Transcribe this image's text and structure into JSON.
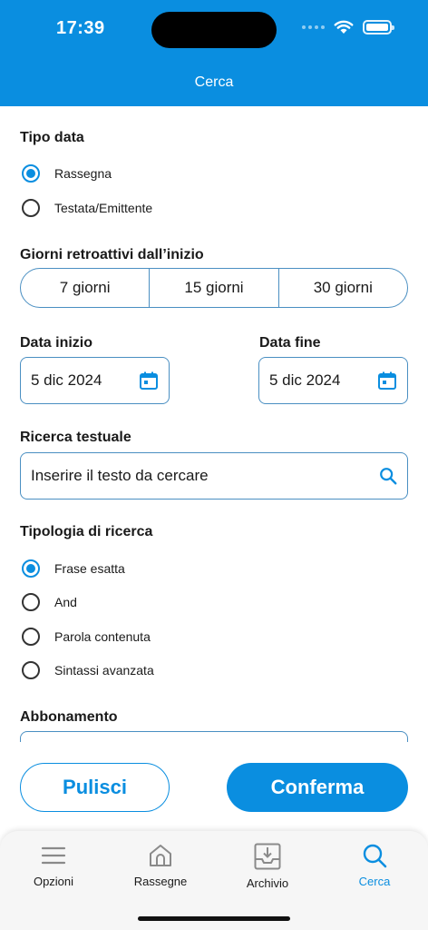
{
  "status_bar": {
    "time": "17:39"
  },
  "header": {
    "title": "Cerca"
  },
  "tipo_data": {
    "label": "Tipo data",
    "options": [
      {
        "label": "Rassegna",
        "checked": true
      },
      {
        "label": "Testata/Emittente",
        "checked": false
      }
    ]
  },
  "giorni": {
    "label": "Giorni retroattivi dall’inizio",
    "options": [
      "7 giorni",
      "15 giorni",
      "30 giorni"
    ]
  },
  "data_inizio": {
    "label": "Data inizio",
    "value": "5 dic 2024"
  },
  "data_fine": {
    "label": "Data fine",
    "value": "5 dic 2024"
  },
  "ricerca": {
    "label": "Ricerca testuale",
    "placeholder": "Inserire il testo da cercare"
  },
  "tipologia": {
    "label": "Tipologia di ricerca",
    "options": [
      {
        "label": "Frase esatta",
        "checked": true
      },
      {
        "label": "And",
        "checked": false
      },
      {
        "label": "Parola contenuta",
        "checked": false
      },
      {
        "label": "Sintassi avanzata",
        "checked": false
      }
    ]
  },
  "abbonamento": {
    "label": "Abbonamento"
  },
  "actions": {
    "clear": "Pulisci",
    "confirm": "Conferma"
  },
  "tabbar": {
    "items": [
      {
        "label": "Opzioni",
        "icon": "menu-icon"
      },
      {
        "label": "Rassegne",
        "icon": "home-icon"
      },
      {
        "label": "Archivio",
        "icon": "archive-icon"
      },
      {
        "label": "Cerca",
        "icon": "search-icon"
      }
    ],
    "active": "Cerca"
  },
  "colors": {
    "accent": "#0a8ee0",
    "border": "#4a8fc2",
    "tabbar_bg": "#f6f6f6"
  }
}
